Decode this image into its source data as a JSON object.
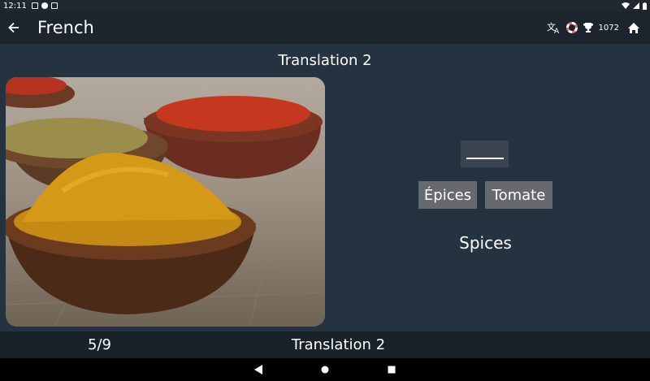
{
  "status_bar": {
    "time": "12:11"
  },
  "app_bar": {
    "title": "French",
    "score": "1072"
  },
  "lesson": {
    "title": "Translation 2",
    "image_alt": "bowls of spices"
  },
  "exercise": {
    "choices": [
      "Épices",
      "Tomate"
    ],
    "prompt": "Spices"
  },
  "footer": {
    "progress": "5/9",
    "title": "Translation 2"
  },
  "colors": {
    "background": "#25323f",
    "app_bar": "#1c252e",
    "choice_bg": "#666a6e"
  },
  "icons": [
    "back-arrow-icon",
    "translate-icon",
    "lifebuoy-icon",
    "trophy-icon",
    "home-icon"
  ]
}
